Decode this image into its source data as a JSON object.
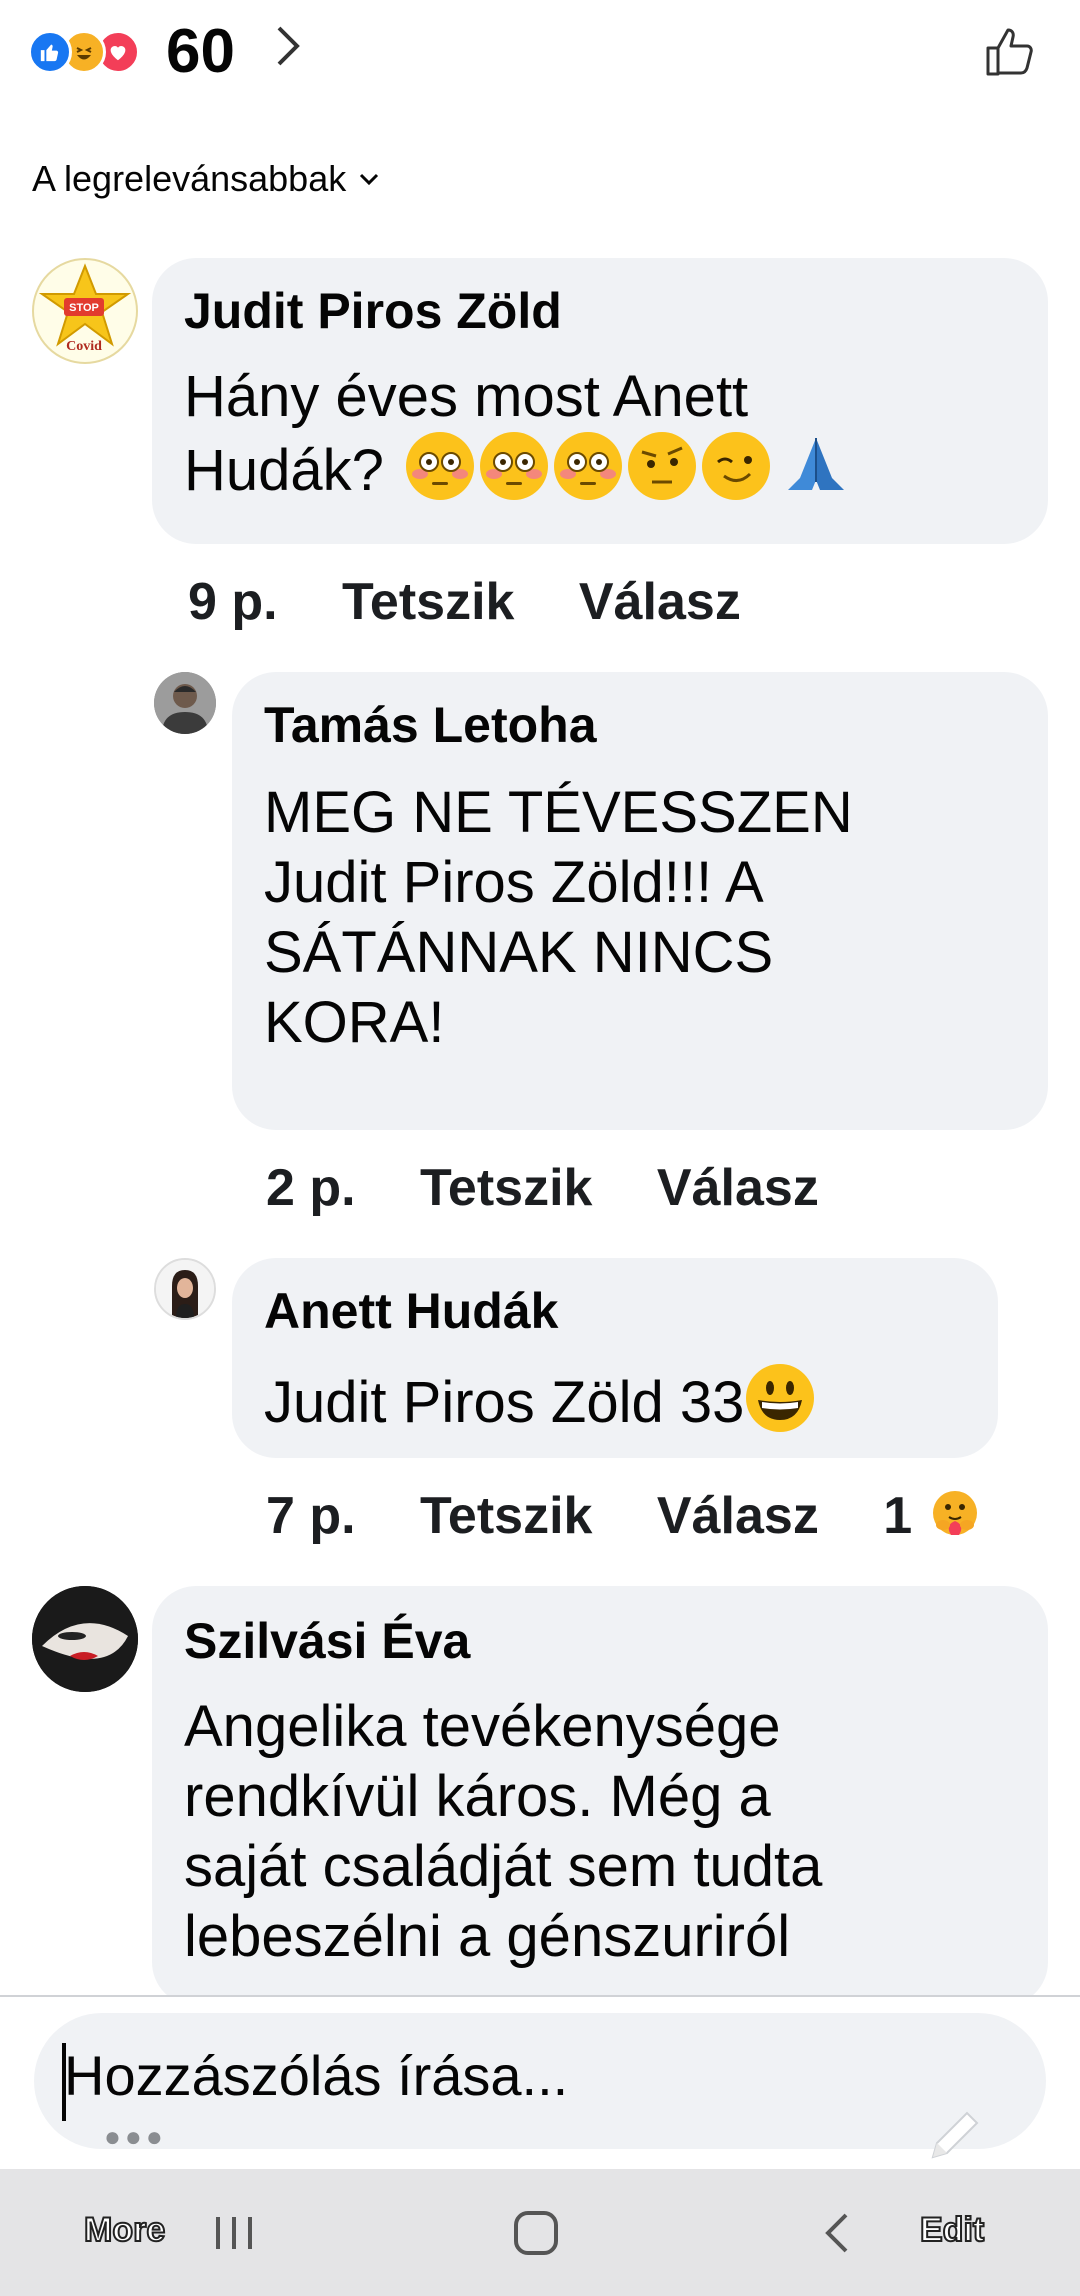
{
  "reactions": {
    "icons": [
      "like-icon",
      "haha-icon",
      "love-icon"
    ],
    "count": "60"
  },
  "sort": {
    "label": "A legrelevánsabbak"
  },
  "comments": [
    {
      "author": "Judit Piros Zöld",
      "avatar_text": "STOP Covid",
      "lines": [
        "Hány éves most Anett",
        "Hudák?"
      ],
      "emojis": [
        "flushed-emoji",
        "flushed-emoji",
        "flushed-emoji",
        "raised-eyebrow-emoji",
        "winking-emoji",
        "folded-hands-emoji"
      ],
      "time": "9 p.",
      "like": "Tetszik",
      "reply": "Válasz"
    },
    {
      "author": "Tamás Letoha",
      "lines": [
        "MEG NE TÉVESSZEN",
        "Judit Piros Zöld!!! A",
        "SÁTÁNNAK NINCS",
        "KORA!"
      ],
      "time": "2 p.",
      "like": "Tetszik",
      "reply": "Válasz"
    },
    {
      "author": "Anett Hudák",
      "lines": [
        "Judit Piros Zöld 33"
      ],
      "emojis": [
        "grinning-emoji"
      ],
      "time": "7 p.",
      "like": "Tetszik",
      "reply": "Válasz",
      "reaction_count": "1",
      "reaction_icon": "care-icon"
    },
    {
      "author": "Szilvási Éva",
      "lines": [
        "Angelika tevékenysége",
        "rendkívül káros. Még a",
        "saját családját sem tudta",
        "lebeszélni a génszuriról"
      ]
    }
  ],
  "composer": {
    "placeholder": "Hozzászólás írása..."
  },
  "navbar": {
    "more": "More",
    "edit": "Edit"
  },
  "colors": {
    "bubble": "#f0f2f5",
    "like_blue": "#1877f2",
    "love_red": "#f33e58",
    "emoji_yellow": "#fcc21b"
  }
}
